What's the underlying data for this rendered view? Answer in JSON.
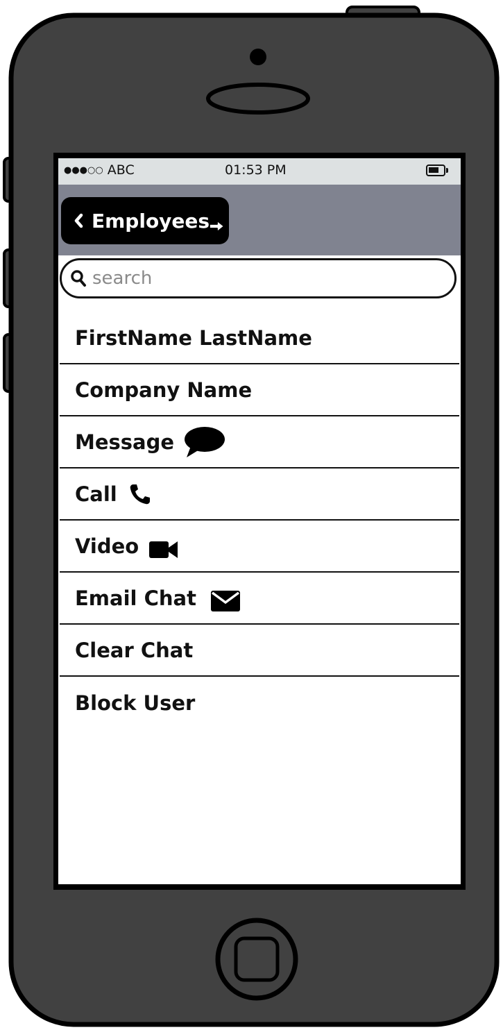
{
  "status_bar": {
    "signal_dots": "●●●○○",
    "carrier": "ABC",
    "time": "01:53 PM",
    "battery_icon": "battery-icon"
  },
  "nav": {
    "back_label": "Employees",
    "back_icon": "chevron-left-icon",
    "cursor_icon": "pointer-arrow-icon"
  },
  "search": {
    "placeholder": "search",
    "icon": "search-icon"
  },
  "menu": {
    "items": [
      {
        "label": "FirstName LastName"
      },
      {
        "label": "Company Name"
      },
      {
        "label": "Message",
        "icon": "speech-bubble-icon"
      },
      {
        "label": "Call",
        "icon": "phone-icon"
      },
      {
        "label": "Video",
        "icon": "video-camera-icon"
      },
      {
        "label": "Email Chat",
        "icon": "envelope-icon"
      },
      {
        "label": "Clear Chat"
      },
      {
        "label": "Block User"
      }
    ]
  },
  "colors": {
    "device_body": "#414141",
    "nav_bar": "#808390",
    "status_bar": "#dde1e2",
    "back_button": "#000000"
  }
}
